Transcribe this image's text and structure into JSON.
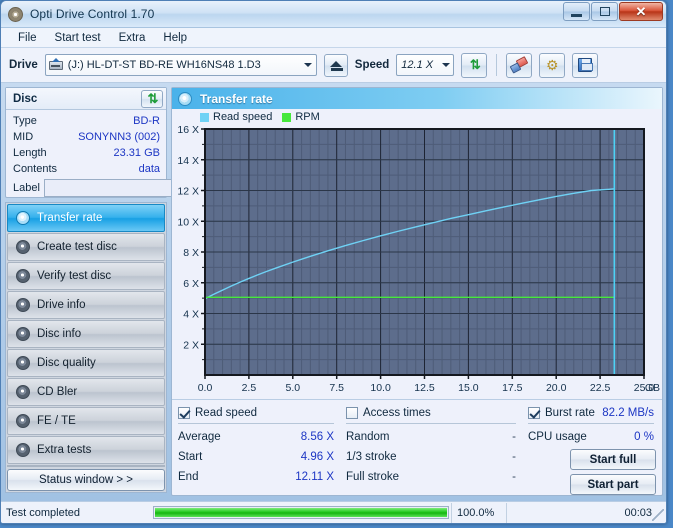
{
  "window": {
    "title": "Opti Drive Control 1.70",
    "icon": "disc-icon",
    "buttons": {
      "minimize": "minimize-icon",
      "maximize": "maximize-icon",
      "close": "close-icon"
    }
  },
  "menubar": {
    "items": [
      "File",
      "Start test",
      "Extra",
      "Help"
    ]
  },
  "toolbar": {
    "drive_label": "Drive",
    "drive_value": "(J:)  HL-DT-ST BD-RE  WH16NS48 1.D3",
    "eject_icon": "eject-icon",
    "speed_label": "Speed",
    "speed_value": "12.1 X",
    "refresh_icon": "refresh-icon",
    "eraser_icon": "eraser-icon",
    "settings_icon": "gear-icon",
    "save_icon": "save-icon"
  },
  "disc": {
    "title": "Disc",
    "refresh_icon": "refresh-icon",
    "rows": [
      {
        "key": "Type",
        "value": "BD-R"
      },
      {
        "key": "MID",
        "value": "SONYNN3 (002)"
      },
      {
        "key": "Length",
        "value": "23.31 GB"
      },
      {
        "key": "Contents",
        "value": "data"
      }
    ],
    "label_key": "Label",
    "label_value": "",
    "label_placeholder": "",
    "label_icon": "disc-icon"
  },
  "sidebar": {
    "items": [
      {
        "label": "Transfer rate",
        "active": true
      },
      {
        "label": "Create test disc",
        "active": false
      },
      {
        "label": "Verify test disc",
        "active": false
      },
      {
        "label": "Drive info",
        "active": false
      },
      {
        "label": "Disc info",
        "active": false
      },
      {
        "label": "Disc quality",
        "active": false
      },
      {
        "label": "CD Bler",
        "active": false
      },
      {
        "label": "FE / TE",
        "active": false
      },
      {
        "label": "Extra tests",
        "active": false
      }
    ],
    "status_window_button": "Status window > >"
  },
  "chart_panel": {
    "title": "Transfer rate",
    "icon": "disc-icon"
  },
  "chart_data": {
    "type": "line",
    "title": "Transfer rate",
    "xlabel": "GB",
    "ylabel": "X",
    "xlim": [
      0.0,
      25.0
    ],
    "ylim": [
      0.0,
      16.0
    ],
    "xticks": [
      "0.0",
      "2.5",
      "5.0",
      "7.5",
      "10.0",
      "12.5",
      "15.0",
      "17.5",
      "20.0",
      "22.5",
      "25.0"
    ],
    "xtick_values": [
      0.0,
      2.5,
      5.0,
      7.5,
      10.0,
      12.5,
      15.0,
      17.5,
      20.0,
      22.5,
      25.0
    ],
    "x_axis_unit": "GB",
    "yticks": [
      "2 X",
      "4 X",
      "6 X",
      "8 X",
      "10 X",
      "12 X",
      "14 X",
      "16 X"
    ],
    "ytick_values": [
      2,
      4,
      6,
      8,
      10,
      12,
      14,
      16
    ],
    "grid": true,
    "legend_position": "top-left",
    "plot_bg": "#5d6d8c",
    "series": [
      {
        "name": "Read speed",
        "color": "#6fd2f5",
        "x": [
          0.0,
          0.5,
          1.0,
          1.5,
          2.0,
          2.5,
          3.0,
          3.5,
          4.0,
          5.0,
          6.0,
          7.0,
          8.0,
          9.0,
          10.0,
          11.0,
          12.0,
          13.0,
          14.0,
          15.0,
          16.0,
          17.0,
          18.0,
          19.0,
          20.0,
          21.0,
          22.0,
          23.0,
          23.31
        ],
        "values": [
          4.96,
          5.25,
          5.52,
          5.79,
          6.04,
          6.28,
          6.51,
          6.73,
          6.94,
          7.34,
          7.72,
          8.08,
          8.42,
          8.74,
          9.05,
          9.35,
          9.63,
          9.91,
          10.18,
          10.43,
          10.68,
          10.92,
          11.16,
          11.39,
          11.61,
          11.82,
          12.0,
          12.08,
          12.11
        ]
      },
      {
        "name": "RPM",
        "color": "#46e83c",
        "x": [
          0.0,
          23.31
        ],
        "values": [
          5.05,
          5.05
        ]
      }
    ],
    "cursor_line": {
      "x": 23.31,
      "color": "#4dd2f5"
    }
  },
  "results": {
    "read_speed": {
      "checkbox_label": "Read speed",
      "checked": true,
      "rows": [
        {
          "key": "Average",
          "value": "8.56 X"
        },
        {
          "key": "Start",
          "value": "4.96 X"
        },
        {
          "key": "End",
          "value": "12.11 X"
        }
      ]
    },
    "access_times": {
      "checkbox_label": "Access times",
      "checked": false,
      "rows": [
        {
          "key": "Random",
          "value": "-"
        },
        {
          "key": "1/3 stroke",
          "value": "-"
        },
        {
          "key": "Full stroke",
          "value": "-"
        }
      ]
    },
    "burst": {
      "checkbox_label": "Burst rate",
      "checked": true,
      "value": "82.2 MB/s",
      "cpu_key": "CPU usage",
      "cpu_value": "0 %",
      "start_full_button": "Start full",
      "start_part_button": "Start part"
    }
  },
  "statusbar": {
    "message": "Test completed",
    "progress_percent": 100.0,
    "progress_text": "100.0%",
    "elapsed": "00:03"
  }
}
